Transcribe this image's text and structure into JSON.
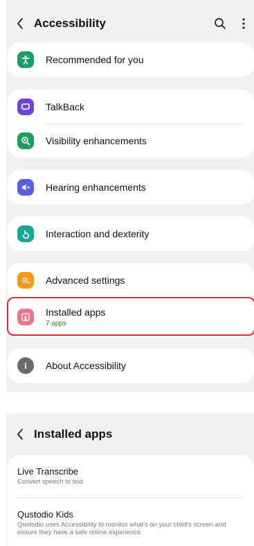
{
  "accessibility": {
    "title": "Accessibility",
    "items": {
      "recommended": {
        "label": "Recommended for you",
        "icon": "accessibility-person-icon",
        "color": "#1d9f6b"
      },
      "talkback": {
        "label": "TalkBack",
        "icon": "talkback-icon",
        "color": "#6b46d6"
      },
      "visibility": {
        "label": "Visibility enhancements",
        "icon": "magnifier-icon",
        "color": "#1a9f5b"
      },
      "hearing": {
        "label": "Hearing enhancements",
        "icon": "hearing-icon",
        "color": "#5b5ee0"
      },
      "interaction": {
        "label": "Interaction and dexterity",
        "icon": "touch-hand-icon",
        "color": "#1aa893"
      },
      "advanced": {
        "label": "Advanced settings",
        "icon": "gear-plus-icon",
        "color": "#f59a1c"
      },
      "installed": {
        "label": "Installed apps",
        "sub": "7 apps",
        "icon": "download-box-icon",
        "color": "#e5788a"
      },
      "about": {
        "label": "About Accessibility",
        "icon": "info-icon",
        "color": "#6a6a6a"
      }
    }
  },
  "installed_apps": {
    "title": "Installed apps",
    "apps": [
      {
        "name": "Live Transcribe",
        "desc": "Convert speech to text"
      },
      {
        "name": "Qustodio Kids",
        "desc": "Qustodio uses Accessibility to monitor what's on your child's screen and ensure they have a safe online experience."
      }
    ]
  },
  "colors": {
    "panel_bg": "#f1f1f1",
    "card_bg": "#ffffff",
    "highlight": "#e02a3b",
    "sub_text": "#3a7d1e"
  }
}
